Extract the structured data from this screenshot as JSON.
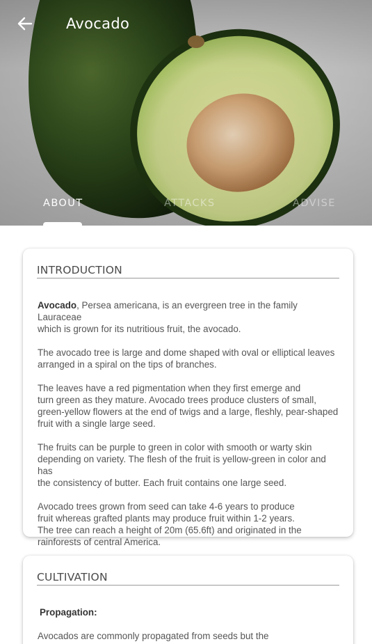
{
  "header": {
    "title": "Avocado",
    "back_icon": "arrow-left-icon"
  },
  "tabs": [
    {
      "label": "ABOUT",
      "active": true
    },
    {
      "label": "ATTACKS",
      "active": false
    },
    {
      "label": "ADVISE",
      "active": false
    }
  ],
  "introduction": {
    "title": "INTRODUCTION",
    "p1_bold": "Avocado",
    "p1_rest": ", Persea americana, is an evergreen tree in the family Lauraceae\nwhich is grown for its nutritious fruit, the avocado.",
    "p2": " The avocado tree is large and dome shaped with oval or elliptical leaves\narranged in a spiral on the tips of branches.",
    "p3": " The leaves have a red pigmentation when they first emerge and\nturn green as they mature. Avocado trees produce clusters of small,\ngreen-yellow flowers at the end of twigs and a large, fleshly, pear-shaped\nfruit with a single large seed.",
    "p4": " The fruits can be purple to green in color with smooth or warty skin\ndepending on variety. The flesh of the fruit is yellow-green in color and has\nthe consistency of butter. Each fruit contains one large seed.",
    "p5": " Avocado trees grown from seed can take 4-6 years to produce\nfruit whereas grafted plants may produce fruit within 1-2 years.\nThe tree can reach a height of 20m (65.6ft) and originated in the\nrainforests of central America."
  },
  "cultivation": {
    "title": "CULTIVATION",
    "subheading": "Propagation:",
    "p1": " Avocados are commonly propagated from seeds but the\nseeds will not breed true to type and this should be taken into"
  },
  "colors": {
    "avocado_skin": "#2f4a1c",
    "avocado_flesh": "#c9d98a",
    "seed": "#c8915e"
  }
}
